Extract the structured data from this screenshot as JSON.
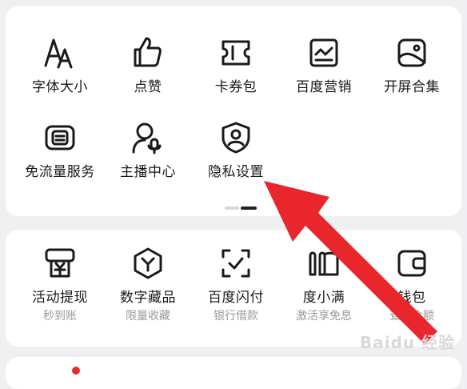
{
  "grid1": {
    "items": [
      {
        "label": "字体大小",
        "icon": "font-size-icon"
      },
      {
        "label": "点赞",
        "icon": "thumbs-up-icon"
      },
      {
        "label": "卡券包",
        "icon": "ticket-icon"
      },
      {
        "label": "百度营销",
        "icon": "marketing-icon"
      },
      {
        "label": "开屏合集",
        "icon": "image-icon"
      },
      {
        "label": "免流量服务",
        "icon": "data-free-icon"
      },
      {
        "label": "主播中心",
        "icon": "anchor-mic-icon"
      },
      {
        "label": "隐私设置",
        "icon": "privacy-shield-icon"
      }
    ]
  },
  "grid2": {
    "items": [
      {
        "label": "活动提现",
        "sub": "秒到账",
        "icon": "withdraw-icon"
      },
      {
        "label": "数字藏品",
        "sub": "限量收藏",
        "icon": "digital-collection-icon"
      },
      {
        "label": "百度闪付",
        "sub": "银行借款",
        "icon": "flash-pay-icon"
      },
      {
        "label": "度小满",
        "sub": "激活享免息",
        "icon": "du-xiaoman-icon"
      },
      {
        "label": "钱包",
        "sub": "查看余额",
        "icon": "wallet-icon"
      }
    ]
  },
  "watermark": "Baidu 经验",
  "colors": {
    "arrow": "#e8262b",
    "background": "#f0f0f2",
    "card": "#ffffff"
  }
}
